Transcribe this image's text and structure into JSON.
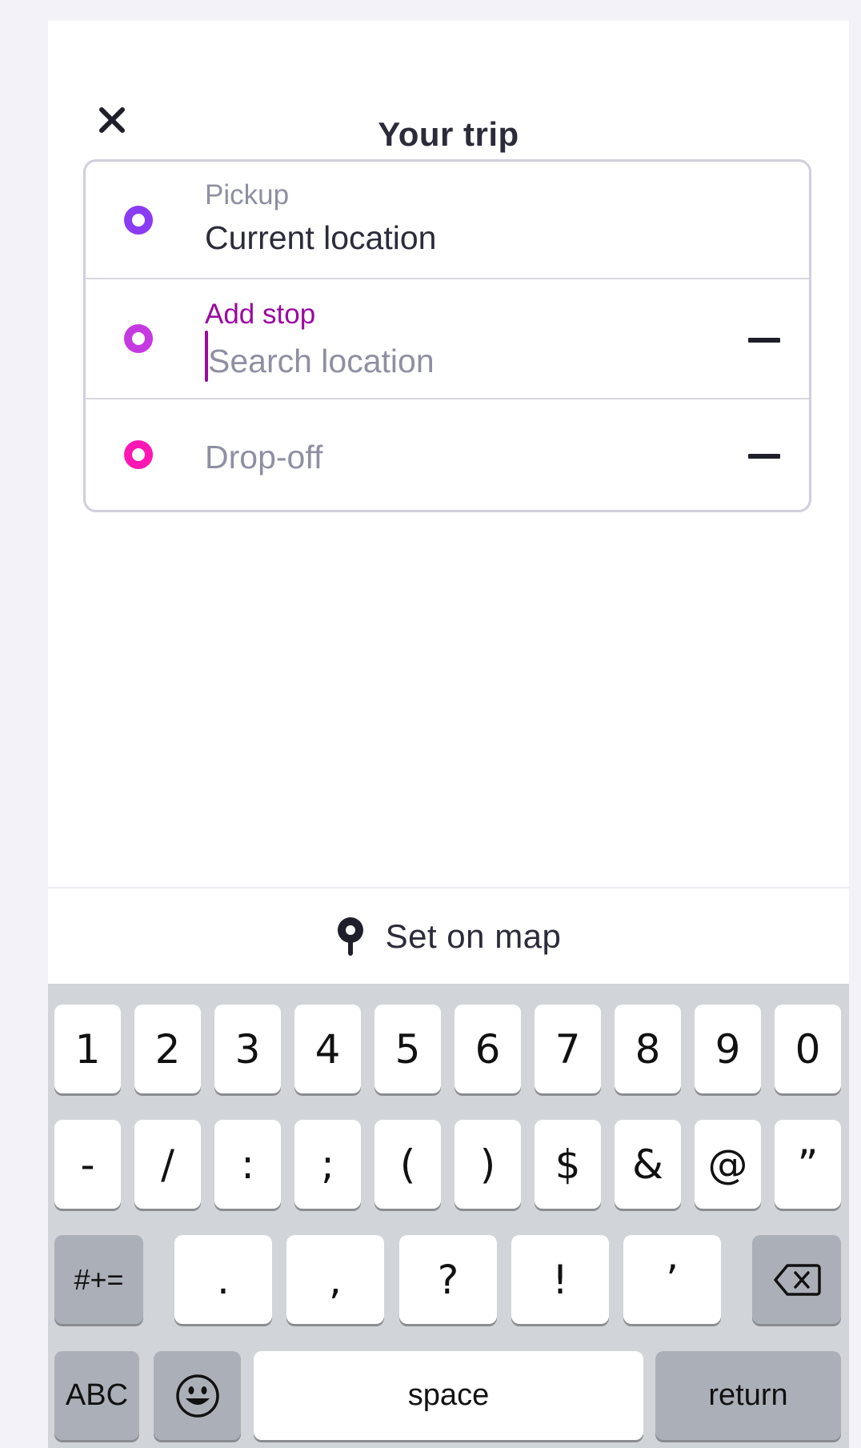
{
  "header": {
    "title": "Your trip",
    "close_icon": "close-icon"
  },
  "trip": {
    "pickup": {
      "label": "Pickup",
      "value": "Current location",
      "dot_color": "#8a3cf5"
    },
    "stop": {
      "label": "Add stop",
      "placeholder": "Search location",
      "dot_color": "#c53ae0"
    },
    "dropoff": {
      "placeholder": "Drop-off",
      "dot_color": "#ff17b4"
    }
  },
  "set_on_map": {
    "label": "Set on map",
    "icon": "map-pin-icon"
  },
  "keyboard": {
    "row1": [
      "1",
      "2",
      "3",
      "4",
      "5",
      "6",
      "7",
      "8",
      "9",
      "0"
    ],
    "row2": [
      "-",
      "/",
      ":",
      ";",
      "(",
      ")",
      "$",
      "&",
      "@",
      "”"
    ],
    "row3": {
      "symbols": "#+=",
      "keys": [
        ".",
        ",",
        "?",
        "!",
        "’"
      ],
      "delete_icon": "backspace-icon"
    },
    "row4": {
      "abc": "ABC",
      "emoji_icon": "emoji-icon",
      "space": "space",
      "return": "return"
    }
  }
}
